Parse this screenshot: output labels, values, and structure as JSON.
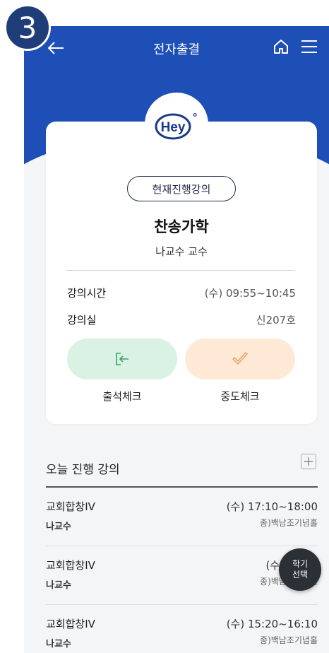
{
  "step_badge": "3",
  "header": {
    "title": "전자출결"
  },
  "logo": {
    "text": "Hey",
    "dot": "°"
  },
  "card": {
    "pill_label": "현재진행강의",
    "course_name": "찬송가학",
    "professor": "나교수 교수",
    "time_label": "강의시간",
    "time_value": "(수) 09:55~10:45",
    "room_label": "강의실",
    "room_value": "신207호",
    "attendance_label": "출석체크",
    "midcheck_label": "중도체크"
  },
  "today": {
    "title": "오늘 진행 강의",
    "rows": [
      {
        "name": "교회합창IV",
        "prof": "나교수",
        "time": "(수) 17:10~18:00",
        "room": "종)백남조기념홀"
      },
      {
        "name": "교회합창IV",
        "prof": "나교수",
        "time": "(수) 16:15",
        "room": "종)백남조기념홀"
      },
      {
        "name": "교회합창IV",
        "prof": "나교수",
        "time": "(수) 15:20~16:10",
        "room": "종)백남조기념홀"
      }
    ]
  },
  "fab": {
    "line1": "학기",
    "line2": "선택"
  },
  "colors": {
    "primary": "#1d4fb7",
    "green_btn": "#d9f2e3",
    "orange_btn": "#fde9d6",
    "fab": "#2b2f36"
  }
}
